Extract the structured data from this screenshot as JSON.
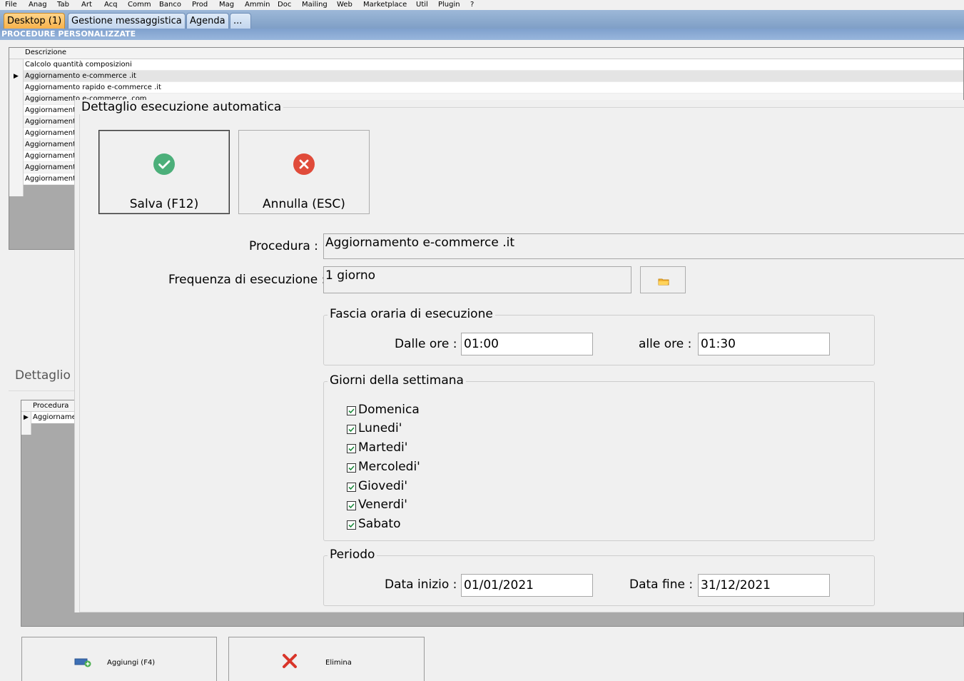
{
  "menu": [
    "File",
    "Anag",
    "Tab",
    "Art",
    "Acq",
    "Comm",
    "Banco",
    "Prod",
    "Mag",
    "Ammin",
    "Doc",
    "Mailing",
    "Web",
    "Marketplace",
    "Util",
    "Plugin",
    "?"
  ],
  "tabs": [
    {
      "label": "Desktop (1)",
      "active": true
    },
    {
      "label": "Gestione messaggistica",
      "active": false
    },
    {
      "label": "Agenda",
      "active": false
    },
    {
      "label": "...",
      "active": false
    }
  ],
  "section_title": "PROCEDURE PERSONALIZZATE",
  "grid1": {
    "header": "Descrizione",
    "rows": [
      "Calcolo quantità composizioni",
      "Aggiornamento e-commerce .it",
      "Aggiornamento rapido e-commerce .it",
      "Aggiornamento e-commerce .com",
      "Aggiornamento",
      "Aggiornamento",
      "Aggiornamento",
      "Aggiornamento",
      "Aggiornamento",
      "Aggiornamento",
      "Aggiornamento"
    ],
    "selected_index": 1
  },
  "bg_detail": {
    "label": "Dettaglio c",
    "header": "Procedura",
    "row": "Aggiornamen"
  },
  "bottom_buttons": {
    "add_label": "Aggiungi (F4)",
    "delete_label": "Elimina"
  },
  "dialog": {
    "title": "Dettaglio esecuzione automatica",
    "save_label": "Salva (F12)",
    "cancel_label": "Annulla (ESC)",
    "procedure_label": "Procedura :",
    "procedure_value": "Aggiornamento e-commerce .it",
    "frequency_label": "Frequenza di esecuzione :",
    "frequency_value": "1 giorno",
    "time_range": {
      "title": "Fascia oraria di esecuzione",
      "from_label": "Dalle ore :",
      "from_value": "01:00",
      "to_label": "alle ore :",
      "to_value": "01:30"
    },
    "weekdays": {
      "title": "Giorni della settimana",
      "days": [
        {
          "label": "Domenica",
          "checked": true
        },
        {
          "label": "Lunedi'",
          "checked": true
        },
        {
          "label": "Martedi'",
          "checked": true
        },
        {
          "label": "Mercoledi'",
          "checked": true
        },
        {
          "label": "Giovedi'",
          "checked": true
        },
        {
          "label": "Venerdi'",
          "checked": true
        },
        {
          "label": "Sabato",
          "checked": true
        }
      ]
    },
    "period": {
      "title": "Periodo",
      "start_label": "Data inizio :",
      "start_value": "01/01/2021",
      "end_label": "Data fine :",
      "end_value": "31/12/2021"
    }
  },
  "colors": {
    "active_tab": "#f7b24b",
    "tab_bar": "#7f9fc6",
    "save_icon": "#4caf7a",
    "cancel_icon": "#e04b3a"
  }
}
